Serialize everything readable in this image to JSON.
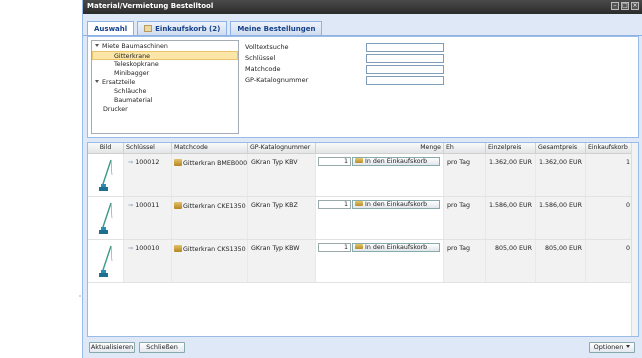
{
  "window": {
    "title": "Material/Vermietung Bestelltool"
  },
  "tabs": [
    {
      "label": "Auswahl"
    },
    {
      "label": "Einkaufskorb (2)"
    },
    {
      "label": "Meine Bestellungen"
    }
  ],
  "tree": {
    "nodes": [
      {
        "label": "Miete Baumaschinen",
        "expanded": true
      },
      {
        "label": "Gitterkrane",
        "selected": true
      },
      {
        "label": "Teleskopkrane"
      },
      {
        "label": "Minibagger"
      },
      {
        "label": "Ersatzteile",
        "expanded": true
      },
      {
        "label": "Schläuche"
      },
      {
        "label": "Baumaterial"
      },
      {
        "label": "Drucker"
      }
    ]
  },
  "filters": [
    {
      "label": "Volltextsuche",
      "value": ""
    },
    {
      "label": "Schlüssel",
      "value": ""
    },
    {
      "label": "Matchcode",
      "value": ""
    },
    {
      "label": "GP-Katalognummer",
      "value": ""
    }
  ],
  "grid": {
    "columns": [
      "Bild",
      "Schlüssel",
      "Matchcode",
      "GP-Katalognummer",
      "Menge",
      "Eh",
      "Einzelpreis",
      "Gesamtpreis",
      "Einkaufskorb"
    ],
    "rows": [
      {
        "key": "100012",
        "matchcode": "Gitterkran BMEB000",
        "catalog": "GKran Typ KBV",
        "qty": "1",
        "add_label": "In den Einkaufskorb",
        "unit": "pro Tag",
        "unit_price": "1.362,00 EUR",
        "total_price": "1.362,00 EUR",
        "cart": "1"
      },
      {
        "key": "100011",
        "matchcode": "Gitterkran CKE1350",
        "catalog": "GKran Typ KBZ",
        "qty": "1",
        "add_label": "In den Einkaufskorb",
        "unit": "pro Tag",
        "unit_price": "1.586,00 EUR",
        "total_price": "1.586,00 EUR",
        "cart": "0"
      },
      {
        "key": "100010",
        "matchcode": "Gitterkran CKS1350",
        "catalog": "GKran Typ KBW",
        "qty": "1",
        "add_label": "In den Einkaufskorb",
        "unit": "pro Tag",
        "unit_price": "805,00 EUR",
        "total_price": "805,00 EUR",
        "cart": "0"
      }
    ]
  },
  "footer": {
    "refresh_label": "Aktualisieren",
    "close_label": "Schließen",
    "options_label": "Optionen"
  },
  "colors": {
    "title_bg": "#333333",
    "panel_bg": "#dfe8f6",
    "selection": "#fbe6a8",
    "tab_text": "#15428b"
  }
}
